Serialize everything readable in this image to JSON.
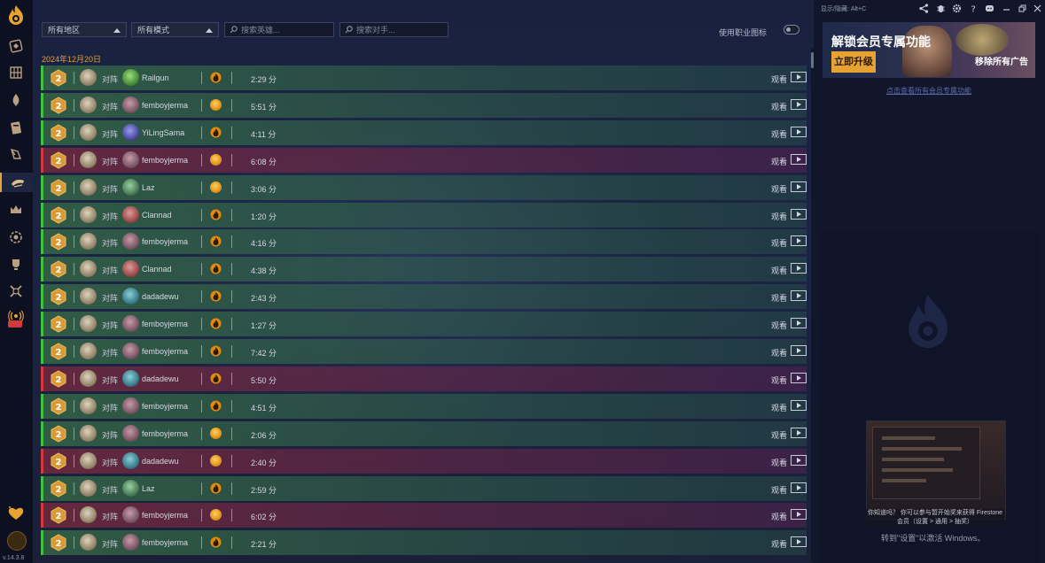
{
  "sidebar": {
    "version": "v.14.3.8",
    "items": [
      {
        "name": "decks-icon"
      },
      {
        "name": "collection-icon"
      },
      {
        "name": "cards-icon"
      },
      {
        "name": "card-book-icon"
      },
      {
        "name": "deck-builder-icon"
      },
      {
        "name": "replays-icon"
      },
      {
        "name": "crown-icon"
      },
      {
        "name": "arena-icon"
      },
      {
        "name": "trophy-icon"
      },
      {
        "name": "battlegrounds-icon"
      },
      {
        "name": "streams-icon"
      }
    ]
  },
  "filters": {
    "region": "所有地区",
    "mode": "所有模式",
    "search_hero_placeholder": "搜索英雄...",
    "search_opponent_placeholder": "搜索对手..."
  },
  "toggle_label": "使用职业图标",
  "date_header": "2024年12月20日",
  "vs_label": "对阵",
  "watch_label": "观看",
  "rows": [
    {
      "result": "win",
      "opponent": "Railgun",
      "duration": "2:29 分",
      "mode": "phoenix"
    },
    {
      "result": "win",
      "opponent": "femboyjerma",
      "duration": "5:51 分",
      "mode": "coin"
    },
    {
      "result": "win",
      "opponent": "YiLingSama",
      "duration": "4:11 分",
      "mode": "phoenix"
    },
    {
      "result": "loss",
      "opponent": "femboyjerma",
      "duration": "6:08 分",
      "mode": "coin"
    },
    {
      "result": "win",
      "opponent": "Laz",
      "duration": "3:06 分",
      "mode": "coin"
    },
    {
      "result": "win",
      "opponent": "Clannad",
      "duration": "1:20 分",
      "mode": "phoenix"
    },
    {
      "result": "win",
      "opponent": "femboyjerma",
      "duration": "4:16 分",
      "mode": "phoenix"
    },
    {
      "result": "win",
      "opponent": "Clannad",
      "duration": "4:38 分",
      "mode": "phoenix"
    },
    {
      "result": "win",
      "opponent": "dadadewu",
      "duration": "2:43 分",
      "mode": "phoenix"
    },
    {
      "result": "win",
      "opponent": "femboyjerma",
      "duration": "1:27 分",
      "mode": "phoenix"
    },
    {
      "result": "win",
      "opponent": "femboyjerma",
      "duration": "7:42 分",
      "mode": "phoenix"
    },
    {
      "result": "loss",
      "opponent": "dadadewu",
      "duration": "5:50 分",
      "mode": "phoenix"
    },
    {
      "result": "win",
      "opponent": "femboyjerma",
      "duration": "4:51 分",
      "mode": "phoenix"
    },
    {
      "result": "win",
      "opponent": "femboyjerma",
      "duration": "2:06 分",
      "mode": "coin"
    },
    {
      "result": "loss",
      "opponent": "dadadewu",
      "duration": "2:40 分",
      "mode": "coin"
    },
    {
      "result": "win",
      "opponent": "Laz",
      "duration": "2:59 分",
      "mode": "phoenix"
    },
    {
      "result": "loss",
      "opponent": "femboyjerma",
      "duration": "6:02 分",
      "mode": "coin"
    },
    {
      "result": "win",
      "opponent": "femboyjerma",
      "duration": "2:21 分",
      "mode": "phoenix"
    }
  ],
  "topbar": {
    "hotkey": "显示/隐藏: Alt+C"
  },
  "ad": {
    "title": "解锁会员专属功能",
    "cta": "立即升级",
    "remove_ads": "移除所有广告",
    "link": "点击查看所有会员专属功能"
  },
  "preview": {
    "caption": "你知道吗？ 你可以参与暂开始奖来获得 Firestone 会员（设置 > 通用 > 抽奖）",
    "windows_notice": "转到\"设置\"以激活 Windows。"
  },
  "colors": {
    "accent": "#e8a231",
    "win": "#3fc23f",
    "loss": "#d2383c"
  }
}
